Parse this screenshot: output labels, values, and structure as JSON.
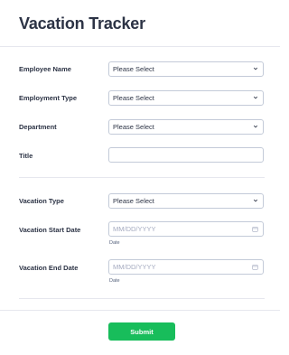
{
  "form": {
    "title": "Vacation Tracker",
    "colors": {
      "primary_button": "#18bd5b",
      "text": "#2c3345",
      "border": "#c3cad8"
    },
    "fields": [
      {
        "label": "Employee Name",
        "type": "select",
        "value": "Please Select"
      },
      {
        "label": "Employment Type",
        "type": "select",
        "value": "Please Select"
      },
      {
        "label": "Department",
        "type": "select",
        "value": "Please Select"
      },
      {
        "label": "Title",
        "type": "text",
        "value": ""
      },
      {
        "label": "Vacation Type",
        "type": "select",
        "value": "Please Select"
      },
      {
        "label": "Vacation Start Date",
        "type": "date",
        "placeholder": "MM/DD/YYYY",
        "sublabel": "Date"
      },
      {
        "label": "Vacation End Date",
        "type": "date",
        "placeholder": "MM/DD/YYYY",
        "sublabel": "Date"
      }
    ],
    "submit_label": "Submit"
  }
}
